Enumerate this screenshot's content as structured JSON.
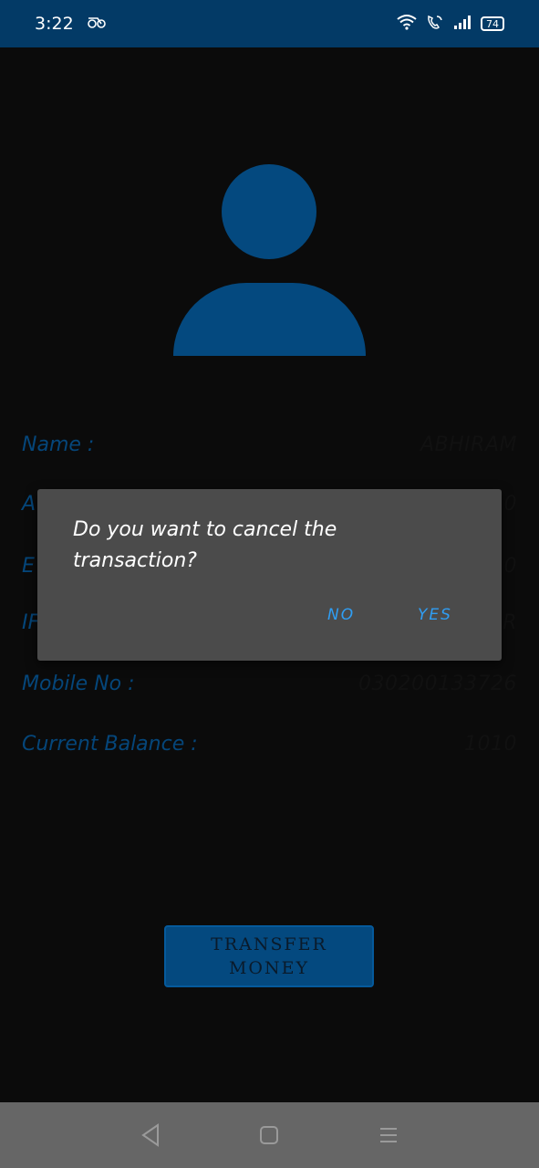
{
  "status_bar": {
    "time": "3:22",
    "battery_level": "74"
  },
  "profile": {
    "fields": [
      {
        "label": "Name :",
        "value": "ABHIRAM"
      },
      {
        "label": "A",
        "value": "0"
      },
      {
        "label": "E",
        "value": "0"
      },
      {
        "label": "IF",
        "value": "R"
      },
      {
        "label": "Mobile No :",
        "value": "030200133726"
      },
      {
        "label": "Current Balance :",
        "value": "1010"
      }
    ],
    "transfer_button_label": "TRANSFER MONEY"
  },
  "dialog": {
    "message": "Do you want to cancel the transaction?",
    "no_label": "NO",
    "yes_label": "YES"
  },
  "colors": {
    "status_bar_bg": "#033a66",
    "accent": "#04497f",
    "dialog_bg": "#4b4b4b",
    "dialog_button": "#2f9ef4",
    "nav_bar_bg": "#666666"
  }
}
